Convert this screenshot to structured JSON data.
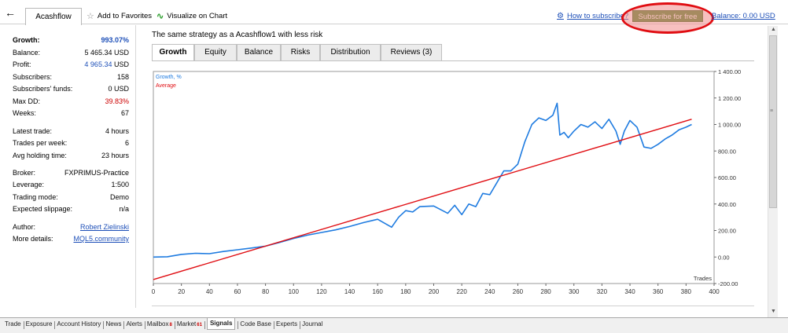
{
  "toolbar": {
    "back_icon": "arrow-left-icon",
    "signal_tab": "Acashflow",
    "add_favorites": "Add to Favorites",
    "visualize_chart": "Visualize on Chart",
    "how_to_subscribe": "How to subscribe?",
    "subscribe_button": "Subscribe for free",
    "balance_link": "Balance: 0.00 USD",
    "annotation_color": "#e00d12"
  },
  "stats": {
    "growth_label": "Growth:",
    "growth_value": "993.07%",
    "balance_label": "Balance:",
    "balance_value": "5 465.34 USD",
    "profit_label": "Profit:",
    "profit_value": "4 965.34",
    "profit_currency": "USD",
    "subscribers_label": "Subscribers:",
    "subscribers_value": "158",
    "funds_label": "Subscribers' funds:",
    "funds_value": "0 USD",
    "maxdd_label": "Max DD:",
    "maxdd_value": "39.83%",
    "weeks_label": "Weeks:",
    "weeks_value": "67",
    "latest_label": "Latest trade:",
    "latest_value": "4 hours",
    "tpw_label": "Trades per week:",
    "tpw_value": "6",
    "hold_label": "Avg holding time:",
    "hold_value": "23 hours",
    "broker_label": "Broker:",
    "broker_value": "FXPRIMUS-Practice",
    "leverage_label": "Leverage:",
    "leverage_value": "1:500",
    "mode_label": "Trading mode:",
    "mode_value": "Demo",
    "slippage_label": "Expected slippage:",
    "slippage_value": "n/a",
    "author_label": "Author:",
    "author_value": "Robert Zielinski",
    "details_label": "More details:",
    "details_value": "MQL5.community"
  },
  "main": {
    "description": "The same strategy as a Acashflow1 with less risk",
    "tabs": [
      "Growth",
      "Equity",
      "Balance",
      "Risks",
      "Distribution",
      "Reviews (3)"
    ],
    "active_tab": "Growth"
  },
  "chart_data": {
    "type": "line",
    "xlabel": "Trades",
    "ylabel": "",
    "xlim": [
      0,
      400
    ],
    "ylim": [
      -200,
      1400
    ],
    "x_ticks": [
      0,
      20,
      40,
      60,
      80,
      100,
      120,
      140,
      160,
      180,
      200,
      220,
      240,
      260,
      280,
      300,
      320,
      340,
      360,
      380,
      400
    ],
    "y_ticks": [
      -200,
      0,
      200,
      400,
      600,
      800,
      1000,
      1200,
      1400
    ],
    "y_tick_labels": [
      "-200.00",
      "0.00",
      "200.00",
      "400.00",
      "600.00",
      "800.00",
      "1 000.00",
      "1 200.00",
      "1 400.00"
    ],
    "grid": false,
    "legend_position": "top-left",
    "series": [
      {
        "name": "Growth, %",
        "color": "#1e7be0",
        "x": [
          0,
          10,
          20,
          30,
          40,
          50,
          60,
          70,
          80,
          90,
          100,
          110,
          120,
          130,
          140,
          150,
          160,
          170,
          175,
          180,
          185,
          190,
          200,
          210,
          215,
          220,
          225,
          230,
          235,
          240,
          245,
          250,
          255,
          260,
          265,
          270,
          275,
          280,
          285,
          288,
          290,
          293,
          296,
          300,
          305,
          310,
          315,
          320,
          325,
          330,
          333,
          336,
          340,
          345,
          350,
          355,
          360,
          365,
          370,
          375,
          380,
          384
        ],
        "y": [
          0,
          2,
          20,
          28,
          25,
          42,
          55,
          68,
          82,
          110,
          140,
          165,
          185,
          205,
          230,
          260,
          285,
          225,
          300,
          350,
          340,
          380,
          385,
          330,
          390,
          320,
          400,
          380,
          480,
          470,
          560,
          650,
          650,
          700,
          870,
          1000,
          1050,
          1030,
          1070,
          1160,
          920,
          940,
          900,
          950,
          1000,
          980,
          1020,
          970,
          1040,
          950,
          850,
          950,
          1030,
          980,
          830,
          820,
          850,
          890,
          920,
          960,
          980,
          1000
        ]
      },
      {
        "name": "Average",
        "color": "#e00d12",
        "x": [
          0,
          384
        ],
        "y": [
          -170,
          1040
        ]
      }
    ]
  },
  "bottom_tabs": [
    {
      "label": "Trade"
    },
    {
      "label": "Exposure"
    },
    {
      "label": "Account History"
    },
    {
      "label": "News"
    },
    {
      "label": "Alerts"
    },
    {
      "label": "Mailbox",
      "badge": "8"
    },
    {
      "label": "Market",
      "badge": "61"
    },
    {
      "label": "Signals"
    },
    {
      "label": "Code Base"
    },
    {
      "label": "Experts"
    },
    {
      "label": "Journal"
    }
  ],
  "active_bottom_tab": "Signals"
}
